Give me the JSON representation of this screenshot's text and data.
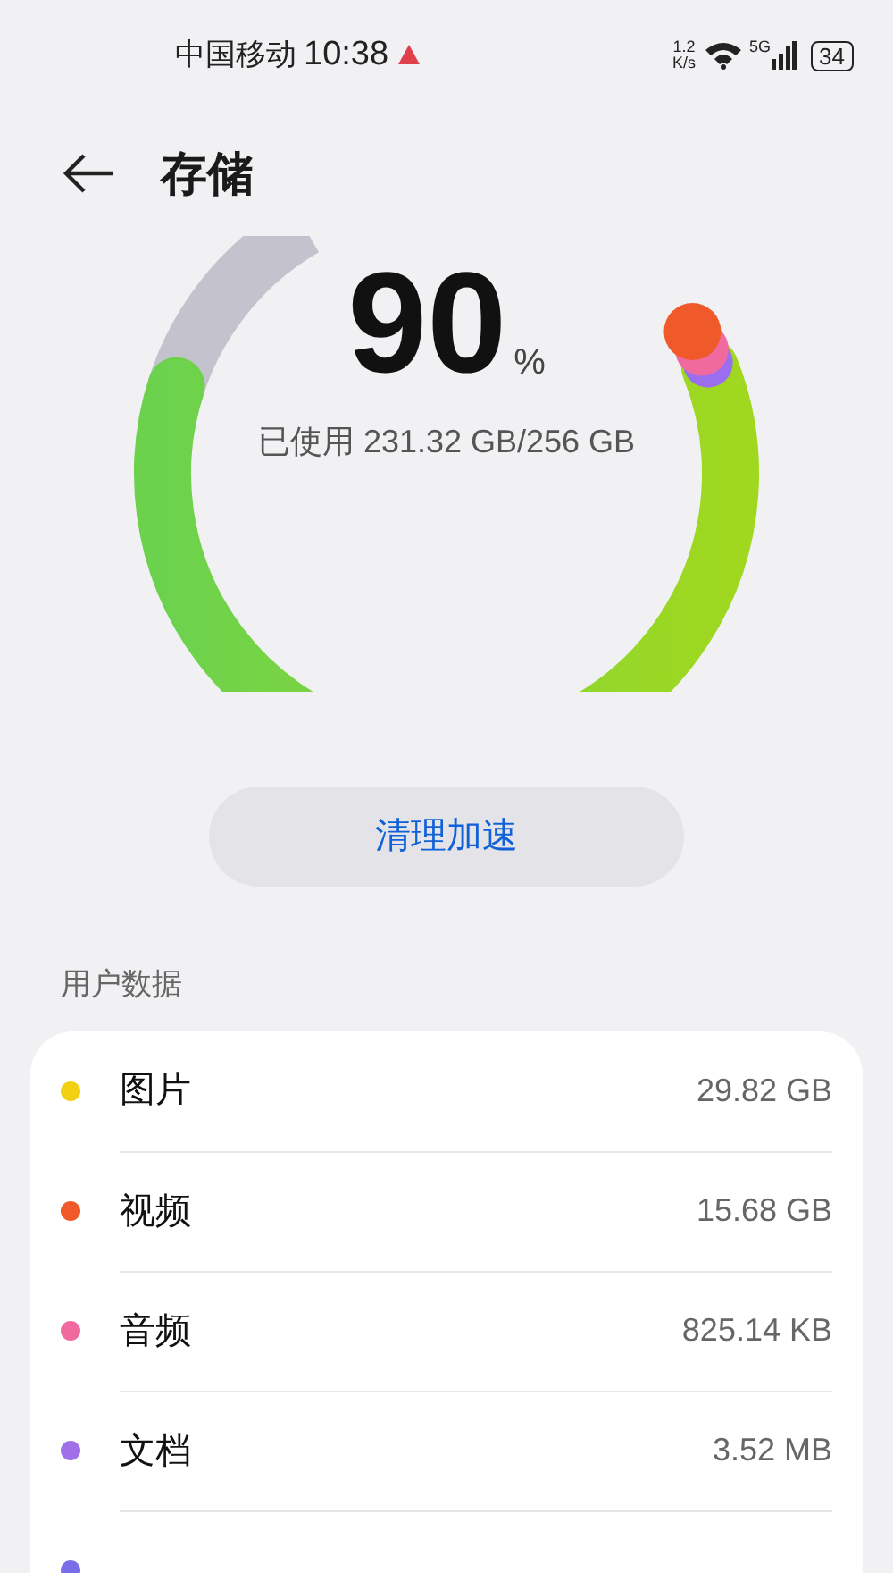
{
  "status_bar": {
    "carrier": "中国移动",
    "time": "10:38",
    "speed_value": "1.2",
    "speed_unit": "K/s",
    "network": "5G",
    "battery": "34"
  },
  "header": {
    "title": "存储"
  },
  "storage": {
    "percent": "90",
    "percent_sign": "%",
    "used": "已使用 231.32 GB/256 GB"
  },
  "clean_button": "清理加速",
  "section_title": "用户数据",
  "items": [
    {
      "name": "图片",
      "size": "29.82 GB",
      "color": "#f2d014"
    },
    {
      "name": "视频",
      "size": "15.68 GB",
      "color": "#f05a2a"
    },
    {
      "name": "音频",
      "size": "825.14 KB",
      "color": "#f06aa0"
    },
    {
      "name": "文档",
      "size": "3.52 MB",
      "color": "#a070e8"
    },
    {
      "color": "#7a6ee8"
    }
  ]
}
